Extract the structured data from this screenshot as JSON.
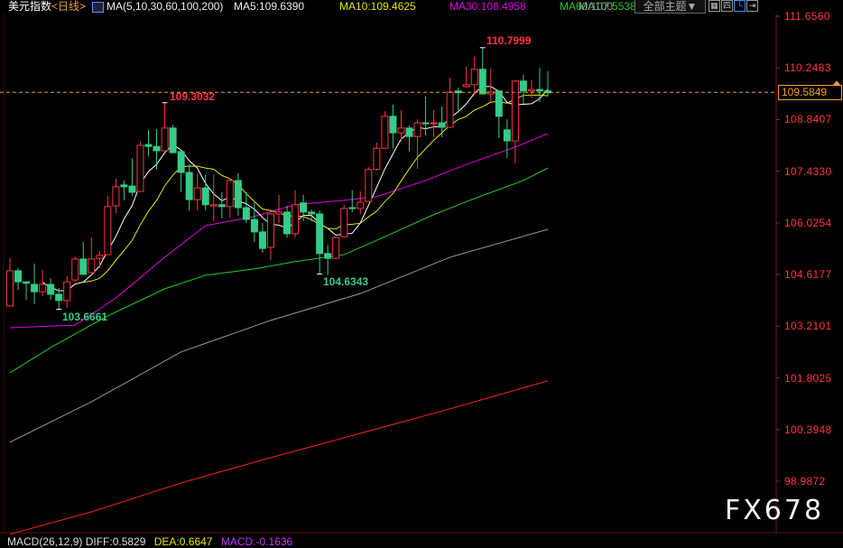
{
  "header": {
    "instrument": "美元指数",
    "period": "<日线>",
    "ma_params": "MA(5,10,30,60,100,200)",
    "ma5": "MA5:109.6390",
    "ma10": "MA10:109.4625",
    "ma30": "MA30:108.4958",
    "ma60": "MA60:107.5538",
    "ma100": "MA100",
    "theme_button": "全部主题▼",
    "icons": [
      "grid-icon",
      "layout-icon",
      "chart-type-icon",
      "exit-icon"
    ]
  },
  "current_price": "109.5849",
  "macd": {
    "label": "MACD(26,12,9) DIFF:0.5829",
    "dea": "DEA:0.6647",
    "macd": "MACD:-0.1636"
  },
  "watermark": "FX678",
  "colors": {
    "up": "#ff3344",
    "down": "#33cc88",
    "ma5": "#ffffff",
    "ma10": "#e6e600",
    "ma30": "#e600e6",
    "ma60": "#22cc22",
    "ma100": "#999999",
    "ma200": "#ff2222",
    "current": "#f0a030"
  },
  "chart_data": {
    "type": "candlestick",
    "title": "美元指数 日线",
    "ylim": [
      98.9872,
      111.656
    ],
    "yticks": [
      "111.6560",
      "110.2483",
      "108.8407",
      "107.4330",
      "106.0254",
      "104.6177",
      "103.2101",
      "101.8025",
      "100.3948",
      "98.9872"
    ],
    "annotations": {
      "high1": {
        "label": "109.3032",
        "index": 19
      },
      "high2": {
        "label": "110.7999",
        "index": 58
      },
      "low1": {
        "label": "103.6661",
        "index": 6
      },
      "low2": {
        "label": "104.6343",
        "index": 38
      }
    },
    "ohlc": [
      [
        103.76,
        105.06,
        103.76,
        104.72
      ],
      [
        104.72,
        104.79,
        104.2,
        104.42
      ],
      [
        104.42,
        104.42,
        103.93,
        104.38
      ],
      [
        104.35,
        104.92,
        103.81,
        104.15
      ],
      [
        104.15,
        104.74,
        104.03,
        104.35
      ],
      [
        104.35,
        104.52,
        103.93,
        104.08
      ],
      [
        104.08,
        104.25,
        103.67,
        103.91
      ],
      [
        103.91,
        104.57,
        103.71,
        104.42
      ],
      [
        104.47,
        105.11,
        104.42,
        105.04
      ],
      [
        105.04,
        105.51,
        104.62,
        104.62
      ],
      [
        104.67,
        105.63,
        104.67,
        105.04
      ],
      [
        105.06,
        105.26,
        104.79,
        105.14
      ],
      [
        105.16,
        106.76,
        105.16,
        106.47
      ],
      [
        106.49,
        107.23,
        106.29,
        107.01
      ],
      [
        107.06,
        107.18,
        106.64,
        107.01
      ],
      [
        107.03,
        107.79,
        106.76,
        106.86
      ],
      [
        106.88,
        108.24,
        106.88,
        108.14
      ],
      [
        108.16,
        108.56,
        107.84,
        108.11
      ],
      [
        108.11,
        108.58,
        107.48,
        107.99
      ],
      [
        107.99,
        109.3,
        107.99,
        108.61
      ],
      [
        108.61,
        108.7,
        107.92,
        107.94
      ],
      [
        107.97,
        107.97,
        106.86,
        107.4
      ],
      [
        107.4,
        107.62,
        106.37,
        106.66
      ],
      [
        106.66,
        107.35,
        106.37,
        106.98
      ],
      [
        106.98,
        107.35,
        106.37,
        106.52
      ],
      [
        106.49,
        107.35,
        106.07,
        106.52
      ],
      [
        106.52,
        106.86,
        106.15,
        106.47
      ],
      [
        106.47,
        107.23,
        106.17,
        107.18
      ],
      [
        107.18,
        107.38,
        106.22,
        106.44
      ],
      [
        106.44,
        106.86,
        106.02,
        106.12
      ],
      [
        106.12,
        106.61,
        105.51,
        105.78
      ],
      [
        105.78,
        106.02,
        105.21,
        105.33
      ],
      [
        105.36,
        106.29,
        105.02,
        106.27
      ],
      [
        106.27,
        106.79,
        106.02,
        106.32
      ],
      [
        106.32,
        106.49,
        105.63,
        105.73
      ],
      [
        105.73,
        106.91,
        105.63,
        106.52
      ],
      [
        106.57,
        106.79,
        106.07,
        106.32
      ],
      [
        106.32,
        106.39,
        106.07,
        106.27
      ],
      [
        106.27,
        106.37,
        104.63,
        105.19
      ],
      [
        105.19,
        105.43,
        104.6,
        105.06
      ],
      [
        105.06,
        105.63,
        105.04,
        105.63
      ],
      [
        105.65,
        106.52,
        105.65,
        106.42
      ],
      [
        106.44,
        106.91,
        106.32,
        106.42
      ],
      [
        106.42,
        106.88,
        106.27,
        106.59
      ],
      [
        106.61,
        107.55,
        106.61,
        107.48
      ],
      [
        107.48,
        108.21,
        107.45,
        108.06
      ],
      [
        108.06,
        109.07,
        108.06,
        108.93
      ],
      [
        108.93,
        109.25,
        108.06,
        108.48
      ],
      [
        108.48,
        109.1,
        108.24,
        108.61
      ],
      [
        108.61,
        108.68,
        107.97,
        108.38
      ],
      [
        108.38,
        108.85,
        107.5,
        108.75
      ],
      [
        108.75,
        109.47,
        108.41,
        108.73
      ],
      [
        108.73,
        109.1,
        108.36,
        108.75
      ],
      [
        108.75,
        109.2,
        108.36,
        108.63
      ],
      [
        108.63,
        109.98,
        108.63,
        109.59
      ],
      [
        109.62,
        109.71,
        109.1,
        109.57
      ],
      [
        109.74,
        110.28,
        109.71,
        109.79
      ],
      [
        109.79,
        110.55,
        109.52,
        110.21
      ],
      [
        110.21,
        110.8,
        109.54,
        109.54
      ],
      [
        109.54,
        110.23,
        109.32,
        109.59
      ],
      [
        109.62,
        109.62,
        108.34,
        108.93
      ],
      [
        108.56,
        108.85,
        107.79,
        108.26
      ],
      [
        108.26,
        109.91,
        107.65,
        109.89
      ],
      [
        109.89,
        110.06,
        109.27,
        109.62
      ],
      [
        109.62,
        109.91,
        109.42,
        109.66
      ],
      [
        109.66,
        110.25,
        109.32,
        109.62
      ],
      [
        109.62,
        110.16,
        109.47,
        109.57
      ]
    ],
    "ma_lines": {
      "ma30": [
        [
          0,
          103.17
        ],
        [
          8,
          103.24
        ],
        [
          13,
          103.98
        ],
        [
          19,
          105.09
        ],
        [
          24,
          105.95
        ],
        [
          30,
          106.2
        ],
        [
          35,
          106.52
        ],
        [
          41,
          106.64
        ],
        [
          45,
          106.74
        ],
        [
          51,
          107.18
        ],
        [
          56,
          107.62
        ],
        [
          62,
          108.09
        ],
        [
          66,
          108.46
        ]
      ],
      "ma60": [
        [
          0,
          101.94
        ],
        [
          5,
          102.63
        ],
        [
          12,
          103.49
        ],
        [
          19,
          104.23
        ],
        [
          24,
          104.6
        ],
        [
          30,
          104.77
        ],
        [
          35,
          104.97
        ],
        [
          41,
          105.16
        ],
        [
          46,
          105.65
        ],
        [
          52,
          106.25
        ],
        [
          57,
          106.69
        ],
        [
          63,
          107.18
        ],
        [
          66,
          107.52
        ]
      ],
      "ma100": [
        [
          0,
          100.05
        ],
        [
          10,
          101.15
        ],
        [
          21,
          102.51
        ],
        [
          32,
          103.37
        ],
        [
          43,
          104.1
        ],
        [
          54,
          105.09
        ],
        [
          66,
          105.85
        ]
      ],
      "ma200": [
        [
          0,
          97.54
        ],
        [
          10,
          98.15
        ],
        [
          21,
          98.94
        ],
        [
          32,
          99.63
        ],
        [
          43,
          100.29
        ],
        [
          54,
          100.96
        ],
        [
          66,
          101.72
        ]
      ]
    }
  }
}
